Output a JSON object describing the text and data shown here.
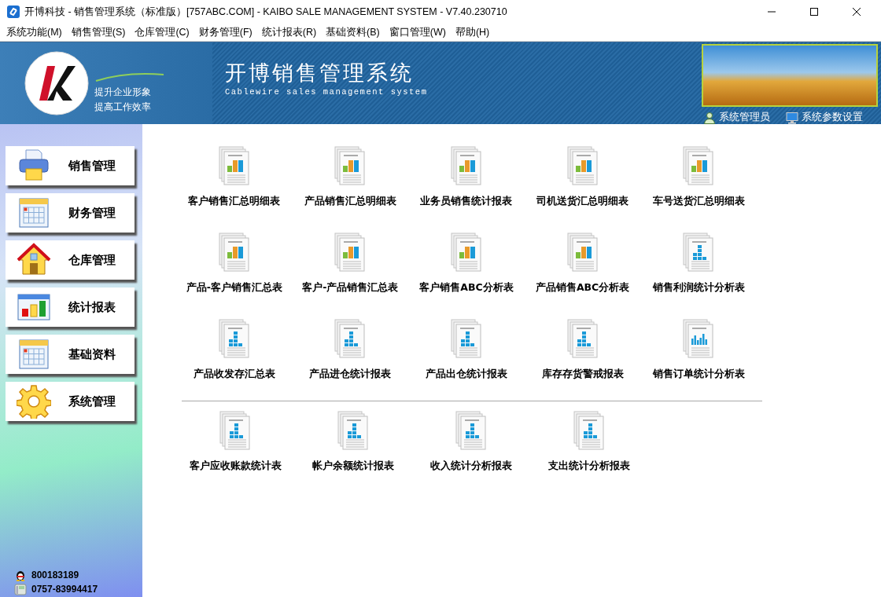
{
  "window": {
    "title": "开博科技 - 销售管理系统（标准版）[757ABC.COM] - KAIBO SALE MANAGEMENT SYSTEM - V7.40.230710"
  },
  "menu": [
    "系统功能(M)",
    "销售管理(S)",
    "仓库管理(C)",
    "财务管理(F)",
    "统计报表(R)",
    "基础资料(B)",
    "窗口管理(W)",
    "帮助(H)"
  ],
  "banner": {
    "slogans": [
      "提升企业形象",
      "提高工作效率"
    ],
    "title": "开博销售管理系统",
    "subtitle": "Cablewire sales management system",
    "links": [
      {
        "kind": "user",
        "label": "系统管理员"
      },
      {
        "kind": "monitor",
        "label": "系统参数设置"
      }
    ]
  },
  "sidebar": {
    "items": [
      {
        "label": "销售管理",
        "kind": "printer"
      },
      {
        "label": "财务管理",
        "kind": "calendar"
      },
      {
        "label": "仓库管理",
        "kind": "house"
      },
      {
        "label": "统计报表",
        "kind": "chart"
      },
      {
        "label": "基础资料",
        "kind": "calendar"
      },
      {
        "label": "系统管理",
        "kind": "gear"
      }
    ],
    "contacts": [
      {
        "kind": "qq",
        "text": "800183189"
      },
      {
        "kind": "phone",
        "text": "0757-83994417"
      }
    ]
  },
  "reports": {
    "groups": [
      {
        "rows": [
          [
            {
              "label": "客户销售汇总明细表",
              "kind": "bars"
            },
            {
              "label": "产品销售汇总明细表",
              "kind": "bars"
            },
            {
              "label": "业务员销售统计报表",
              "kind": "bars"
            },
            {
              "label": "司机送货汇总明细表",
              "kind": "bars"
            },
            {
              "label": "车号送货汇总明细表",
              "kind": "bars"
            }
          ],
          [
            {
              "label": "产品-客户销售汇总表",
              "kind": "bars"
            },
            {
              "label": "客户-产品销售汇总表",
              "kind": "bars"
            },
            {
              "label": "客户销售ABC分析表",
              "kind": "bars"
            },
            {
              "label": "产品销售ABC分析表",
              "kind": "bars"
            },
            {
              "label": "销售利润统计分析表",
              "kind": "blocks"
            }
          ],
          [
            {
              "label": "产品收发存汇总表",
              "kind": "blocks"
            },
            {
              "label": "产品进仓统计报表",
              "kind": "blocks"
            },
            {
              "label": "产品出仓统计报表",
              "kind": "blocks"
            },
            {
              "label": "库存存货警戒报表",
              "kind": "blocks"
            },
            {
              "label": "销售订单统计分析表",
              "kind": "columns"
            }
          ]
        ]
      },
      {
        "rows": [
          [
            {
              "label": "客户应收账款统计表",
              "kind": "blocks"
            },
            {
              "label": "帐户余额统计报表",
              "kind": "blocks"
            },
            {
              "label": "收入统计分析报表",
              "kind": "blocks"
            },
            {
              "label": "支出统计分析报表",
              "kind": "blocks"
            }
          ]
        ]
      }
    ]
  }
}
